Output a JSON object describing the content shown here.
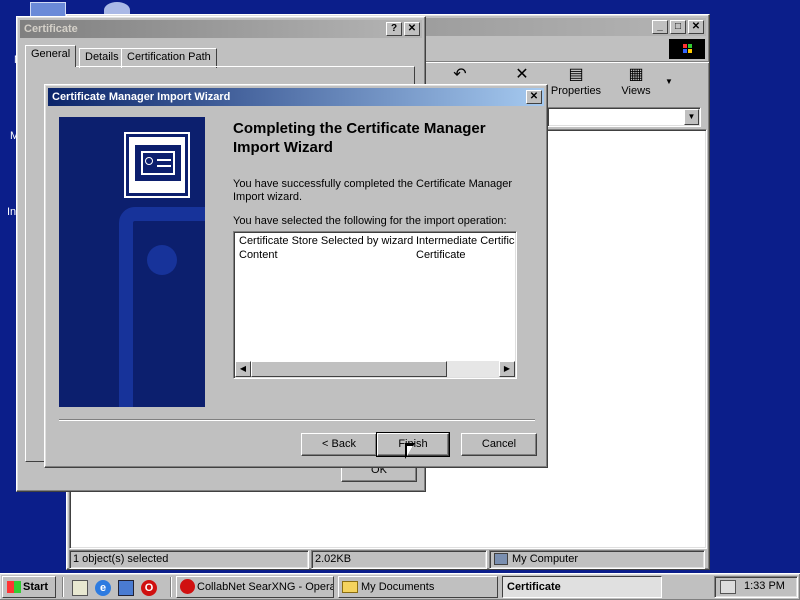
{
  "desktop": {
    "icons": [
      {
        "label": "M",
        "top": 0
      },
      {
        "label": "M",
        "top": 0
      },
      {
        "label": "In",
        "top": 0
      }
    ]
  },
  "explorer": {
    "toolbar": {
      "properties": "Properties",
      "views": "Views"
    },
    "status": {
      "selected": "1 object(s) selected",
      "size": "2.02KB",
      "location": "My Computer"
    }
  },
  "certificate": {
    "title": "Certificate",
    "help_btn": "?",
    "close_btn": "✕",
    "tabs": [
      "General",
      "Details",
      "Certification Path"
    ],
    "ok_label": "OK"
  },
  "wizard": {
    "title": "Certificate Manager Import Wizard",
    "heading": "Completing the Certificate Manager Import Wizard",
    "success_text": "You have successfully completed the Certificate Manager Import wizard.",
    "selection_text": "You have selected the following for the import operation:",
    "rows": [
      {
        "name": "Certificate Store Selected by wizard",
        "value": "Intermediate Certifica"
      },
      {
        "name": "Content",
        "value": "Certificate"
      }
    ],
    "back_label": "< Back",
    "finish_label": "Finish",
    "cancel_label": "Cancel"
  },
  "taskbar": {
    "start": "Start",
    "tasks": [
      {
        "label": "CollabNet SearXNG - Opera"
      },
      {
        "label": "My Documents"
      },
      {
        "label": "Certificate"
      }
    ],
    "clock": "1:33 PM"
  },
  "colors": {
    "desktop": "#0b1e8a",
    "title_active": "#0a246a",
    "face": "#c0c0c0"
  }
}
